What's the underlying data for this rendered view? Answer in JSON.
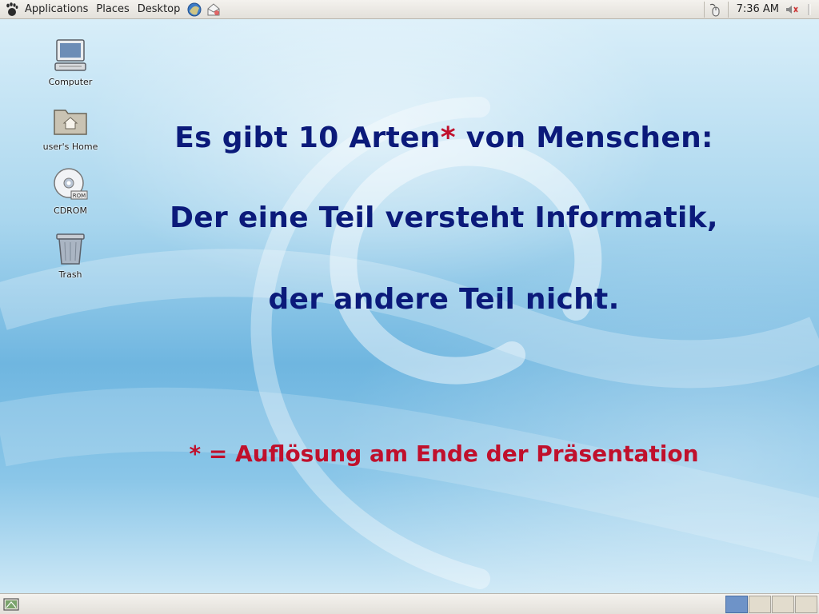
{
  "top_panel": {
    "menus": [
      "Applications",
      "Places",
      "Desktop"
    ],
    "clock": "7:36 AM",
    "icons": [
      "gnome-foot-icon",
      "web-browser-icon",
      "email-icon",
      "mouse-applet-icon",
      "volume-icon"
    ]
  },
  "desktop": {
    "icons": [
      {
        "label": "Computer",
        "icon": "computer-icon"
      },
      {
        "label": "user's Home",
        "icon": "home-folder-icon"
      },
      {
        "label": "CDROM",
        "icon": "cdrom-icon"
      },
      {
        "label": "Trash",
        "icon": "trash-icon"
      }
    ]
  },
  "slide": {
    "line1_before": "Es gibt 10 Arten",
    "asterisk": "*",
    "line1_after": " von Menschen:",
    "line2": "Der eine Teil versteht Informatik,",
    "line3": "der andere Teil nicht.",
    "footnote": "* = Auflösung am Ende der Präsentation"
  },
  "bottom_panel": {
    "workspaces": 4,
    "active_workspace": 1
  },
  "colors": {
    "slide_text": "#0b1a7a",
    "accent_red": "#c0102c"
  }
}
